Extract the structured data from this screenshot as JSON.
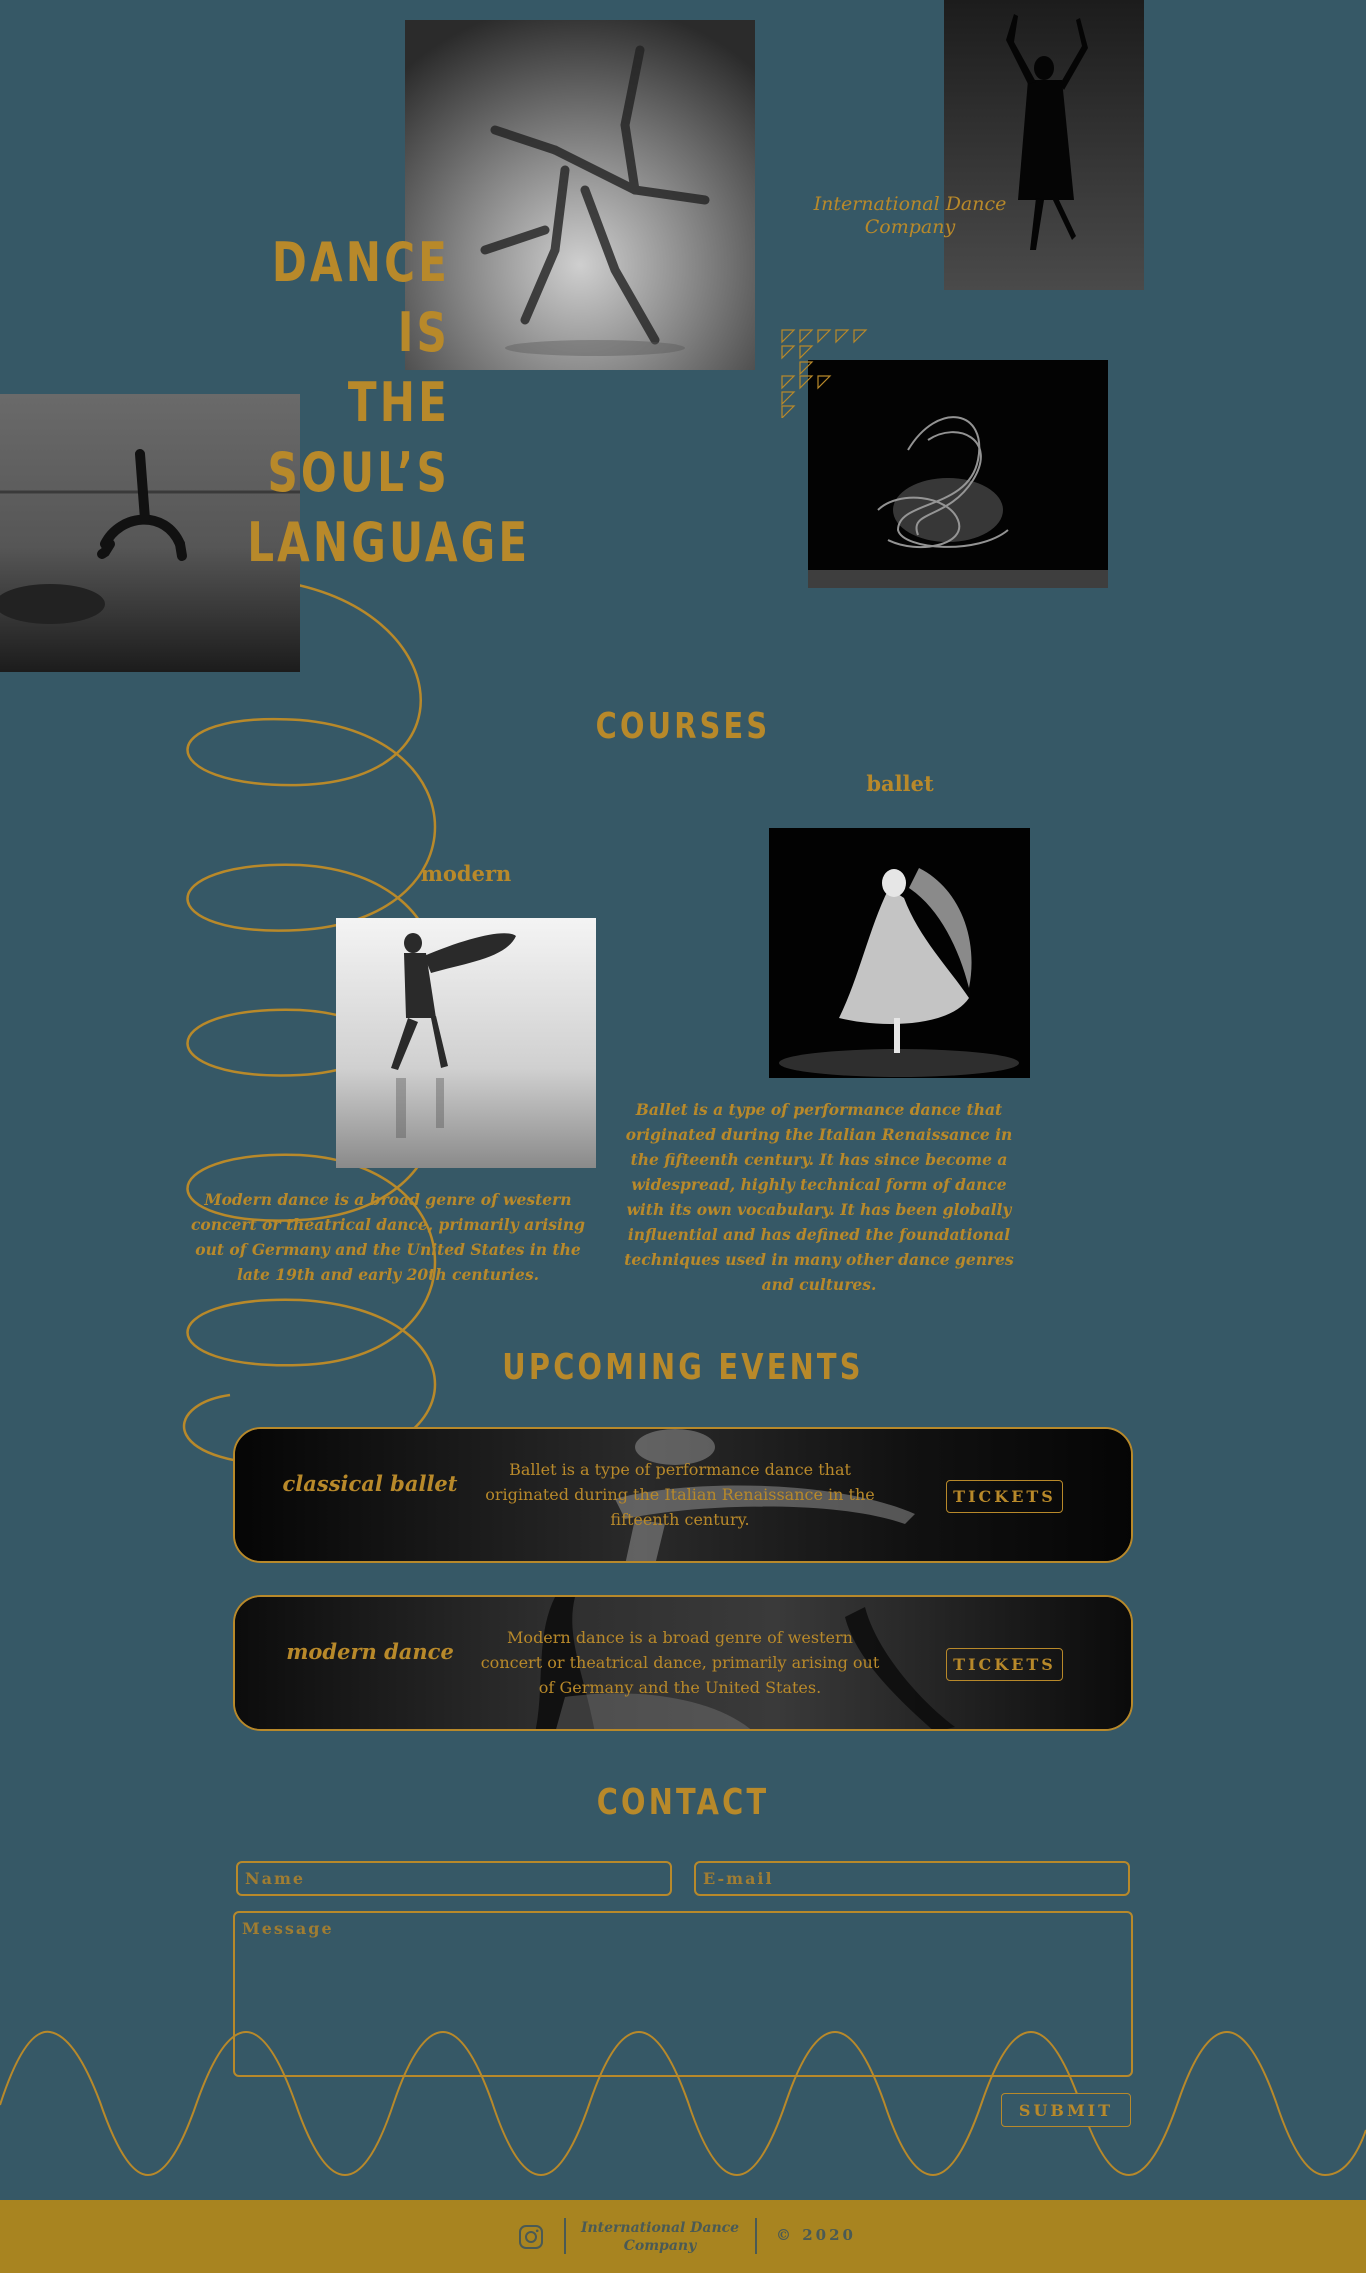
{
  "hero": {
    "title_lines": [
      "DANCE IS",
      "THE",
      "SOUL’S",
      "LANGUAGE"
    ],
    "company": "International Dance Company"
  },
  "courses": {
    "title": "COURSES",
    "items": [
      {
        "name": "ballet",
        "description": "Ballet is a type of performance dance that originated during the Italian Renaissance in the fifteenth century. It has since become a widespread, highly technical form of dance with its own vocabulary. It has been globally influential and has defined the foundational techniques used in many other dance genres and cultures."
      },
      {
        "name": "modern",
        "description": "Modern dance is a broad genre of western concert or theatrical dance, primarily arising out of Germany and the United States in the late 19th and early 20th centuries."
      }
    ]
  },
  "events": {
    "title": "UPCOMING EVENTS",
    "items": [
      {
        "name": "classical ballet",
        "description": "Ballet is a type of performance dance that originated during the Italian Renaissance in the fifteenth century.",
        "button": "TICKETS"
      },
      {
        "name": "modern dance",
        "description": "Modern dance is a broad genre of western concert or theatrical dance, primarily arising out of Germany and the United States.",
        "button": "TICKETS"
      }
    ]
  },
  "contact": {
    "title": "CONTACT",
    "name_placeholder": "Name",
    "email_placeholder": "E-mail",
    "message_placeholder": "Message",
    "submit": "SUBMIT"
  },
  "footer": {
    "icon": "instagram-icon",
    "company": "International Dance Company",
    "copyright": "© 2020"
  },
  "colors": {
    "background": "#365866",
    "accent": "#b8892a",
    "footer": "#a88420"
  }
}
